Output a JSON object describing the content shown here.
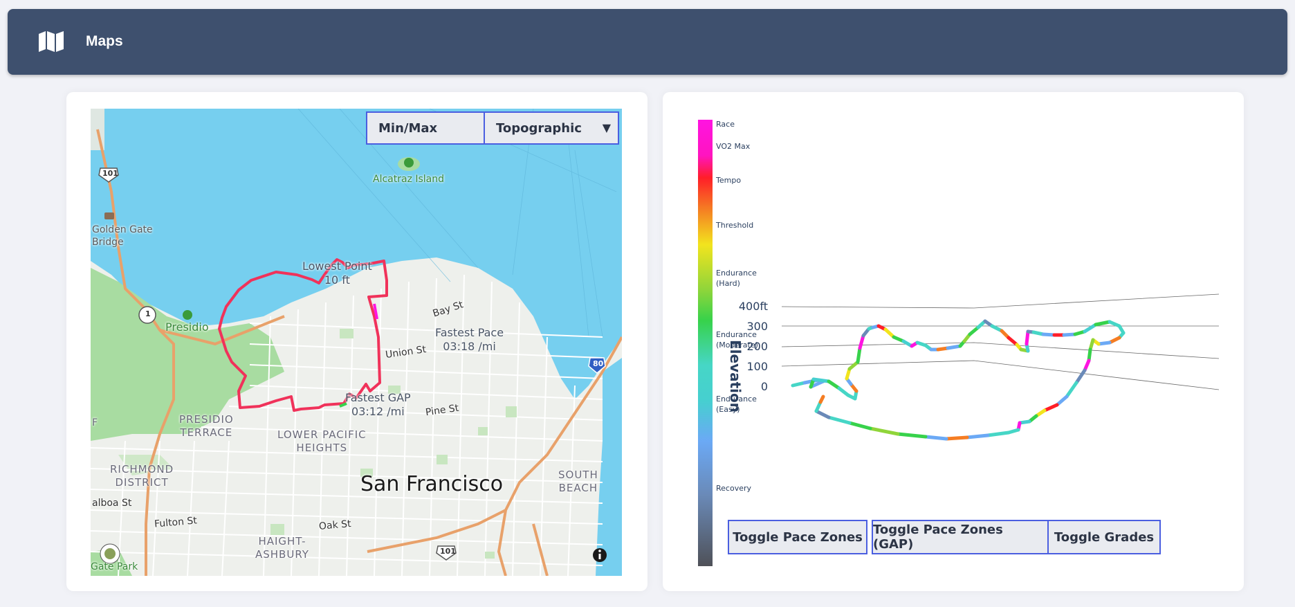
{
  "app": {
    "title": "Maps",
    "icon": "map-icon"
  },
  "map": {
    "mode_select": {
      "value": "Min/Max"
    },
    "style_select": {
      "value": "Topographic"
    },
    "place_labels": {
      "alcatraz": "Alcatraz Island",
      "golden_gate": "Golden Gate\nBridge",
      "presidio": "Presidio",
      "presidio_terrace": "PRESIDIO\nTERRACE",
      "lower_pacific_heights": "LOWER PACIFIC\nHEIGHTS",
      "richmond": "RICHMOND\nDISTRICT",
      "san_francisco": "San Francisco",
      "south_beach": "SOUTH\nBEACH",
      "haight": "HAIGHT-\nASHBURY",
      "balboa": "alboa St",
      "fulton": "Fulton St",
      "oak": "Oak St",
      "pine": "Pine St",
      "union": "Union St",
      "bay": "Bay St",
      "gate_park": "Gate Park",
      "f_fragment": "F"
    },
    "shields": {
      "us101_top": "101",
      "ca1": "1",
      "i80": "80",
      "us101_bottom": "101"
    },
    "annotations": {
      "lowest_point": {
        "label": "Lowest Point",
        "value": "10 ft"
      },
      "fastest_pace": {
        "label": "Fastest Pace",
        "value": "03:18 /mi"
      },
      "fastest_gap": {
        "label": "Fastest GAP",
        "value": "03:12 /mi"
      }
    },
    "route_color": "#f0325a",
    "water_color": "#76cfef",
    "park_color": "#a8dca1"
  },
  "chart_data": {
    "type": "line",
    "title": "",
    "colorbar": {
      "title": "Elevation",
      "zones": [
        "Race",
        "VO2 Max",
        "Tempo",
        "Threshold",
        "Endurance\n(Hard)",
        "Endurance\n(Moderate)",
        "Endurance\n(Easy)",
        "Recovery"
      ],
      "colors": [
        "#ff14e1",
        "#ff1e28",
        "#f57d23",
        "#f2e41e",
        "#37d24b",
        "#46d6c6",
        "#6ba9f5",
        "#4f5158"
      ]
    },
    "zaxis": {
      "ticks": [
        "400ft",
        "300",
        "200",
        "100",
        "0"
      ],
      "range": [
        0,
        400
      ]
    }
  },
  "buttons": {
    "pace_zones": "Toggle Pace Zones",
    "pace_zones_gap": "Toggle Pace Zones (GAP)",
    "grades": "Toggle Grades"
  }
}
